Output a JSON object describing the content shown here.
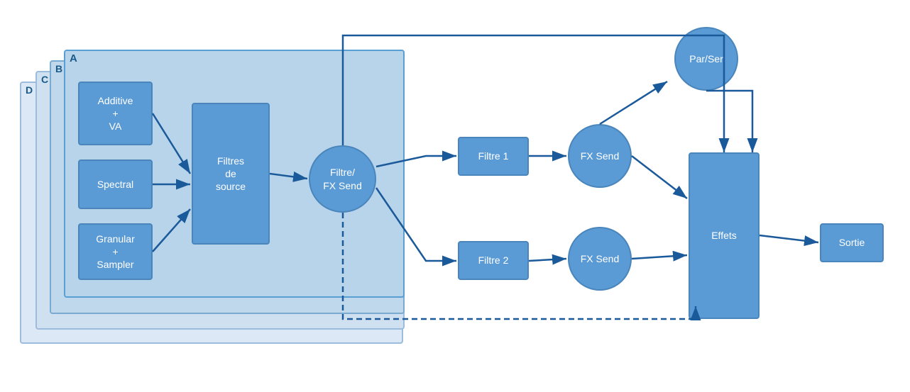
{
  "panels": {
    "a_label": "A",
    "b_label": "B",
    "c_label": "C",
    "d_label": "D"
  },
  "boxes": {
    "additive_va": "Additive\n+\nVA",
    "spectral": "Spectral",
    "granular": "Granular\n+\nSampler",
    "filtres_source": "Filtres\nde\nsource",
    "filtre_fx_send": "Filtre/\nFX Send",
    "filtre1": "Filtre 1",
    "filtre2": "Filtre 2",
    "fx_send1": "FX Send",
    "fx_send2": "FX Send",
    "par_ser": "Par/Ser",
    "effets": "Effets",
    "sortie": "Sortie"
  },
  "colors": {
    "box_fill": "#5b9bd5",
    "box_border": "#4a85bc",
    "arrow": "#1a5a9a",
    "panel_a_bg": "#b8d4ea",
    "panel_b_bg": "#c0d8ec",
    "panel_c_bg": "#cfe0f0",
    "panel_d_bg": "#dce8f5"
  }
}
